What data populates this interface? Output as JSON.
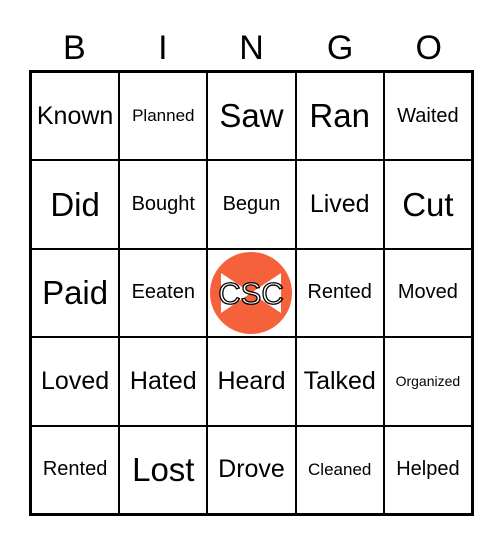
{
  "header": [
    "B",
    "I",
    "N",
    "G",
    "O"
  ],
  "cells": [
    [
      "Known",
      "Planned",
      "Saw",
      "Ran",
      "Waited"
    ],
    [
      "Did",
      "Bought",
      "Begun",
      "Lived",
      "Cut"
    ],
    [
      "Paid",
      "Eeaten",
      "",
      "Rented",
      "Moved"
    ],
    [
      "Loved",
      "Hated",
      "Heard",
      "Talked",
      "Organized"
    ],
    [
      "Rented",
      "Lost",
      "Drove",
      "Cleaned",
      "Helped"
    ]
  ],
  "free_space": {
    "logo_text": "CSC",
    "color": "#f5613a",
    "icon": "bowtie-logo"
  }
}
